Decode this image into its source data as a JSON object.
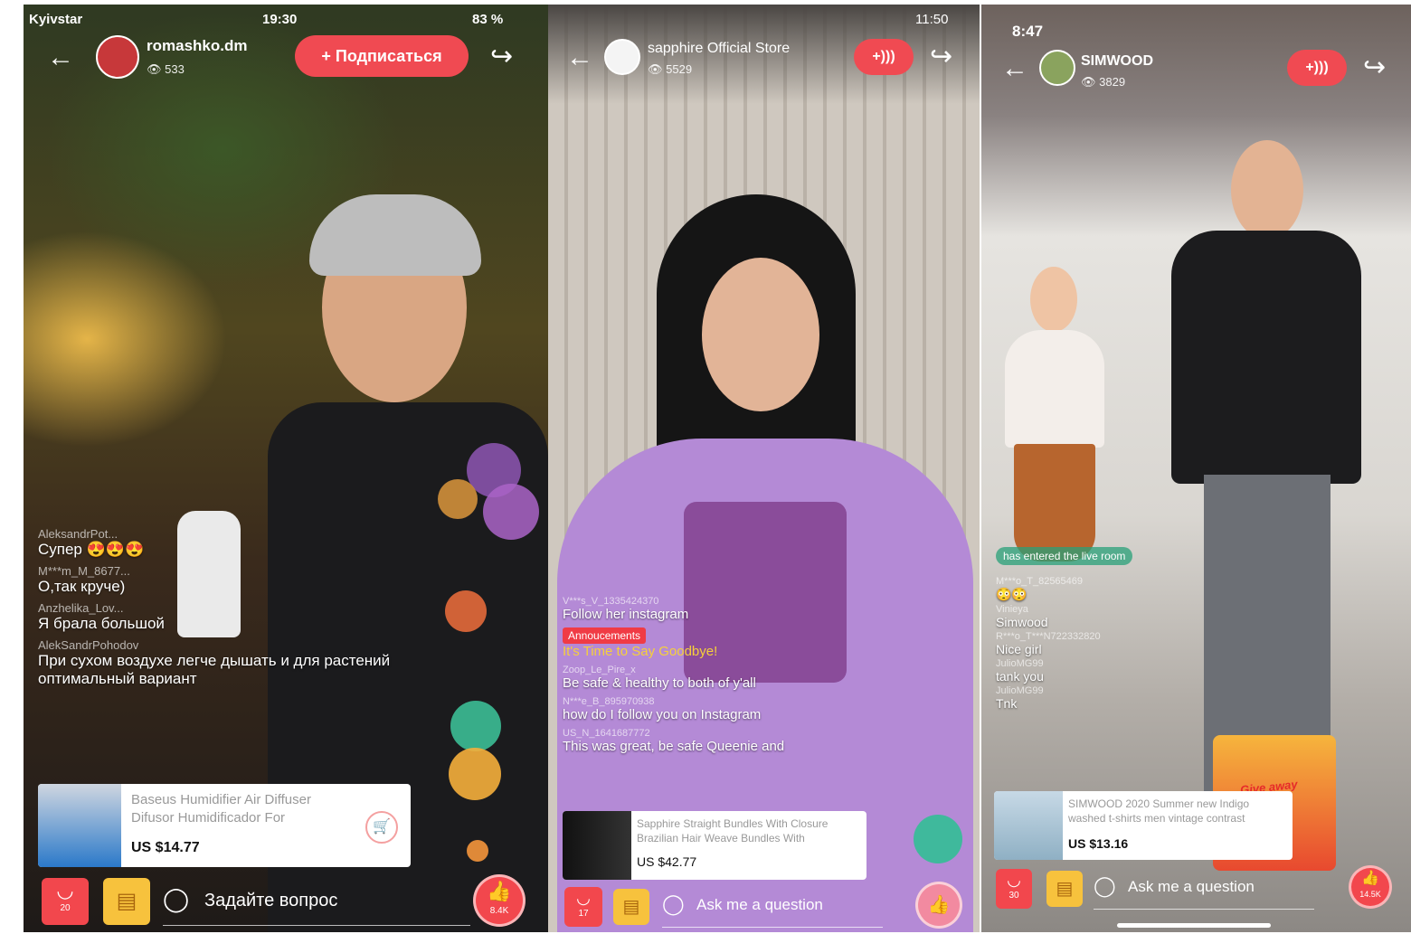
{
  "colors": {
    "accent_red": "#f2474d",
    "accent_yellow": "#f7c23d",
    "overlay_text": "#ffffff"
  },
  "streams": [
    {
      "status": {
        "carrier": "Kyivstar",
        "time": "19:30",
        "battery": "83 %"
      },
      "header": {
        "back_icon": "←",
        "username": "romashko.dm",
        "viewers": "533",
        "follow_label": "+ Подписаться",
        "share_icon": "↪"
      },
      "comments": [
        {
          "user": "AleksandrPot...",
          "text": "Супер 😍😍😍"
        },
        {
          "user": "M***m_M_8677...",
          "text": "О,так круче)"
        },
        {
          "user": "Anzhelika_Lov...",
          "text": "Я брала большой"
        },
        {
          "user": "AlekSandrPohodov",
          "text": "При сухом воздухе легче дышать и для растений оптимальный вариант"
        }
      ],
      "product": {
        "title": "Baseus Humidifier Air Diffuser Difusor Humidificador For",
        "price": "US $14.77",
        "cart_icon": "🛒"
      },
      "bottom": {
        "bag_count": "20",
        "ask_placeholder": "Задайте вопрос",
        "likes": "8.4K"
      }
    },
    {
      "status": {
        "time": "11:50"
      },
      "header": {
        "back_icon": "←",
        "username": "sapphire Official Store",
        "viewers": "5529",
        "follow_label": "+)))",
        "share_icon": "↪"
      },
      "comments": [
        {
          "user": "V***s_V_1335424370",
          "text": "Follow her instagram"
        },
        {
          "badge": "Annoucements",
          "text": "It's Time to Say Goodbye!"
        },
        {
          "user": "Zoop_Le_Pire_x",
          "text": "Be safe & healthy to both of y'all"
        },
        {
          "user": "N***e_B_895970938",
          "text": "how do I follow you on Instagram"
        },
        {
          "user": "US_N_1641687772",
          "text": "This was great, be safe Queenie and"
        }
      ],
      "product": {
        "title": "Sapphire Straight Bundles With Closure Brazilian Hair Weave Bundles With",
        "price": "US $42.77"
      },
      "bottom": {
        "bag_count": "17",
        "ask_placeholder": "Ask me a question"
      }
    },
    {
      "status": {
        "time": "8:47"
      },
      "header": {
        "back_icon": "←",
        "username": "SIMWOOD",
        "viewers": "3829",
        "follow_label": "+)))",
        "share_icon": "↪"
      },
      "entered_text": "has entered the live room",
      "comments": [
        {
          "user": "M***o_T_82565469",
          "text": "😳😳"
        },
        {
          "user": "Vinieya",
          "text": "Simwood"
        },
        {
          "user": "R***o_T***N722332820",
          "text": "Nice girl"
        },
        {
          "user": "JulioMG99",
          "text": "tank you"
        },
        {
          "user": "JulioMG99",
          "text": "Tnk"
        }
      ],
      "product": {
        "title": "SIMWOOD 2020 Summer new Indigo washed t-shirts men vintage contrast",
        "price": "US $13.16",
        "giveaway": "Give away"
      },
      "bottom": {
        "bag_count": "30",
        "ask_placeholder": "Ask me a question",
        "likes": "14.5K"
      }
    }
  ]
}
